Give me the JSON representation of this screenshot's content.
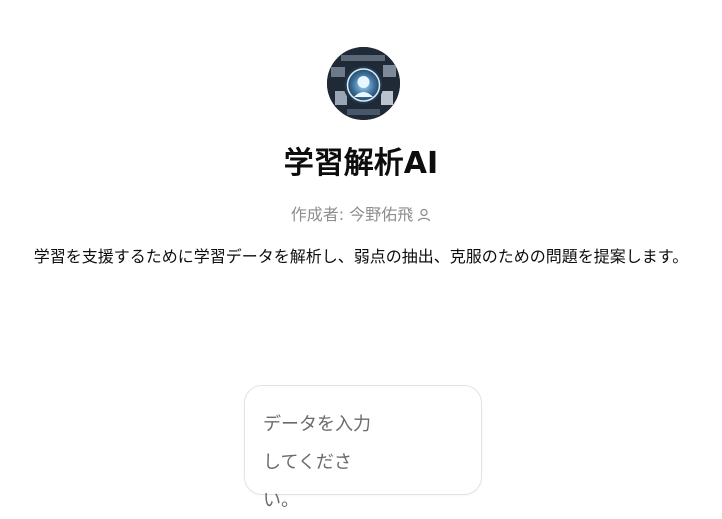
{
  "gpt": {
    "avatar_icon": "ai-robot-avatar-icon",
    "title": "学習解析AI",
    "author_prefix": "作成者: ",
    "author_name": "今野佑飛",
    "author_icon": "person-icon",
    "description": "学習を支援するために学習データを解析し、弱点の抽出、克服のための問題を提案します。"
  },
  "conversation_starters": [
    {
      "label": "データを入力してください。"
    }
  ]
}
